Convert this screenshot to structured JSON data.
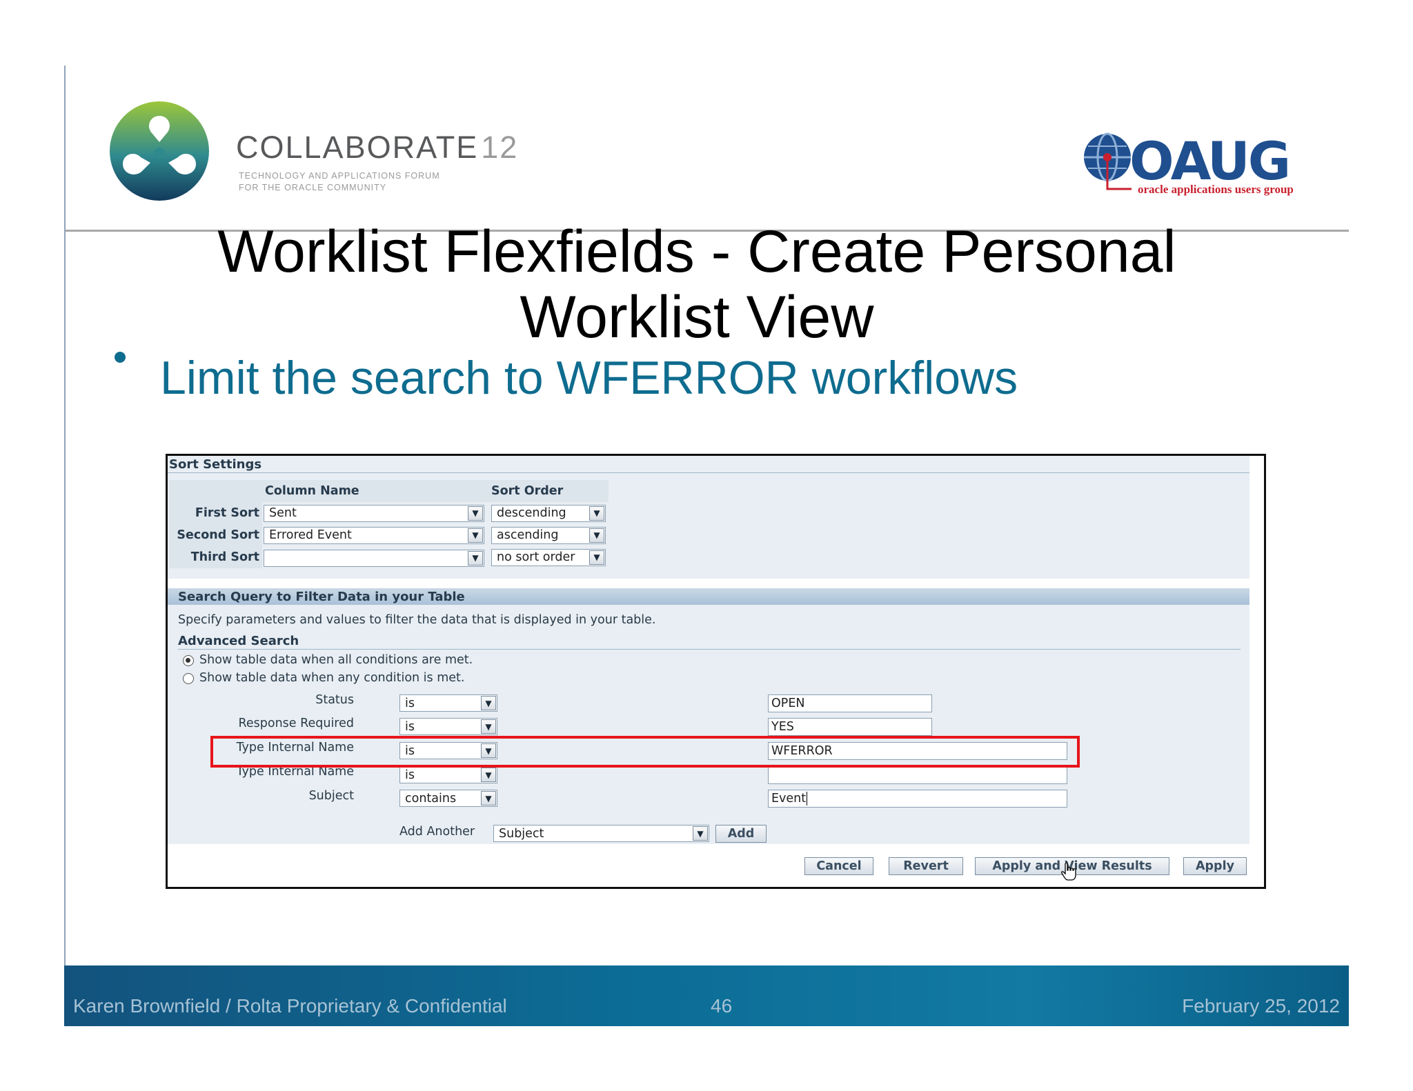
{
  "branding": {
    "collaborate_word": "COLLABORATE",
    "collaborate_num": "12",
    "collaborate_tagline": "TECHNOLOGY AND APPLICATIONS FORUM\nFOR THE ORACLE COMMUNITY",
    "oaug_word": "OAUG",
    "oaug_tagline": "oracle applications users group"
  },
  "slide": {
    "title_line1": "Worklist Flexfields - Create Personal",
    "title_line2": "Worklist View",
    "bullet": "Limit the search to WFERROR workflows"
  },
  "sort_settings": {
    "title": "Sort Settings",
    "col_header": "Column Name",
    "order_header": "Sort Order",
    "rows": [
      {
        "label": "First Sort",
        "column": "Sent",
        "order": "descending"
      },
      {
        "label": "Second Sort",
        "column": "Errored Event",
        "order": "ascending"
      },
      {
        "label": "Third Sort",
        "column": "",
        "order": "no sort order"
      }
    ]
  },
  "search_query": {
    "title": "Search Query to Filter Data in your Table",
    "description": "Specify parameters and values to filter the data that is displayed in your table.",
    "advanced_title": "Advanced Search",
    "radio_all": "Show table data when all conditions are met.",
    "radio_any": "Show table data when any condition is met.",
    "criteria": [
      {
        "label": "Status",
        "operator": "is",
        "value": "OPEN"
      },
      {
        "label": "Response Required",
        "operator": "is",
        "value": "YES"
      },
      {
        "label": "Type Internal Name",
        "operator": "is",
        "value": "WFERROR"
      },
      {
        "label": "Type Internal Name",
        "operator": "is",
        "value": ""
      },
      {
        "label": "Subject",
        "operator": "contains",
        "value": "Event"
      }
    ],
    "add_another_label": "Add Another",
    "add_another_value": "Subject",
    "add_button": "Add"
  },
  "actions": {
    "cancel": "Cancel",
    "revert": "Revert",
    "apply_view": "Apply and View Results",
    "apply": "Apply"
  },
  "footer": {
    "author": "Karen Brownfield  /  Rolta  Proprietary & Confidential",
    "page": "46",
    "date": "February 25, 2012"
  },
  "colors": {
    "title_blue": "#0e6c8f",
    "highlight_red": "#e8141b",
    "footer_blue": "#0c6d96"
  }
}
